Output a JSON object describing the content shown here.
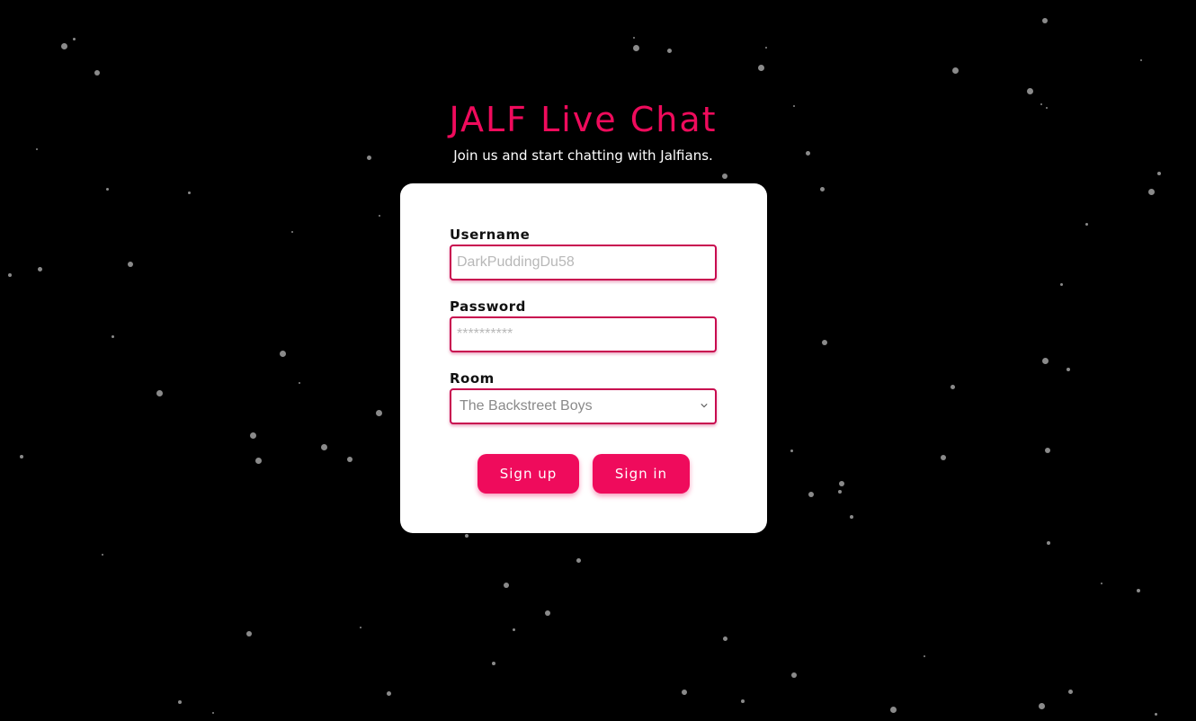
{
  "page": {
    "title": "JALF Live Chat",
    "subtitle": "Join us and start chatting with Jalfians."
  },
  "form": {
    "username": {
      "label": "Username",
      "placeholder": "DarkPuddingDu58",
      "value": ""
    },
    "password": {
      "label": "Password",
      "placeholder": "**********",
      "value": ""
    },
    "room": {
      "label": "Room",
      "selected": "The Backstreet Boys"
    },
    "buttons": {
      "signup": "Sign up",
      "signin": "Sign in"
    }
  },
  "colors": {
    "accent": "#ef0b5c",
    "field_border": "#c8094f",
    "background": "#000000",
    "card": "#ffffff"
  }
}
